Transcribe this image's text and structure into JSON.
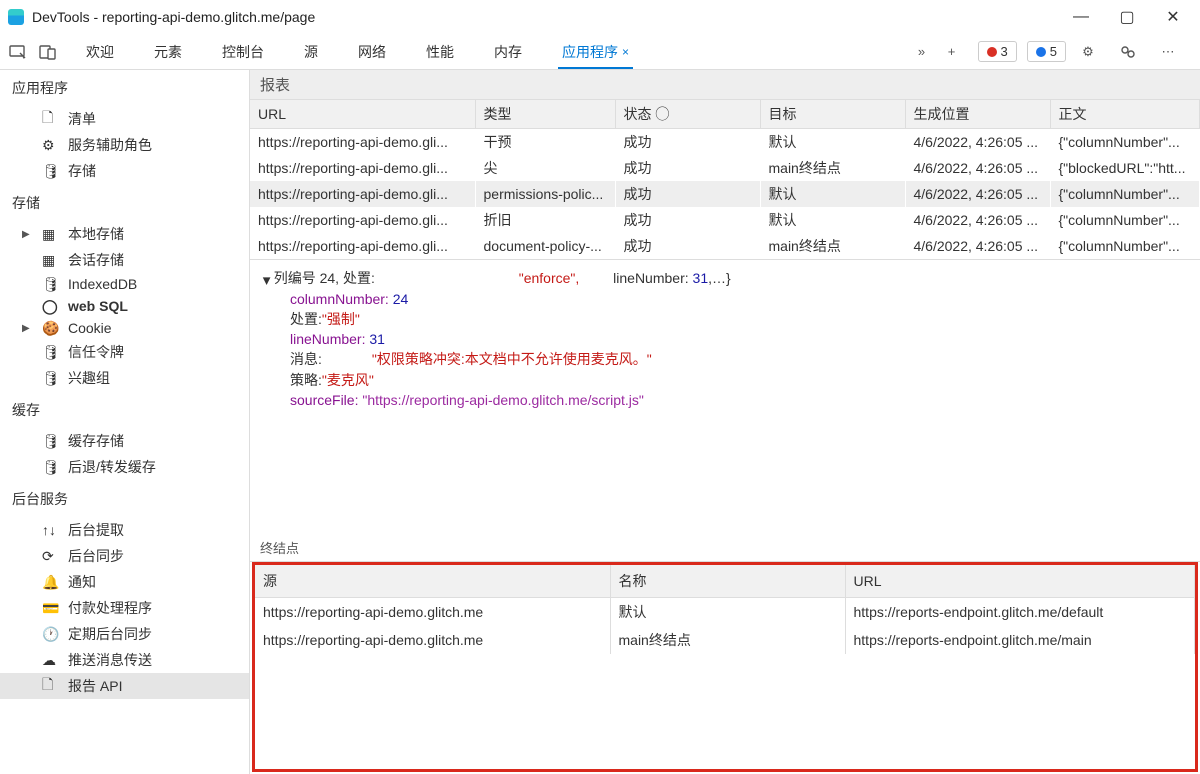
{
  "window": {
    "title": "DevTools - reporting-api-demo.glitch.me/page"
  },
  "tabs": {
    "items": [
      "欢迎",
      "元素",
      "控制台",
      "源",
      "网络",
      "性能",
      "内存",
      "应用程序"
    ],
    "active_close": "×"
  },
  "badges": {
    "errors": "3",
    "info": "5"
  },
  "sidebar": {
    "app_header": "应用程序",
    "app": {
      "manifest": "清单",
      "service_workers": "服务辅助角色",
      "storage": "存储"
    },
    "storage_header": "存储",
    "storage": {
      "local": "本地存储",
      "session": "会话存储",
      "indexeddb": "IndexedDB",
      "websql": "web SQL",
      "cookie": "Cookie",
      "trust": "信任令牌",
      "interest": "兴趣组"
    },
    "cache_header": "缓存",
    "cache": {
      "cache_storage": "缓存存储",
      "back_forward": "后退/转发缓存"
    },
    "bg_header": "后台服务",
    "bg": {
      "fetch": "后台提取",
      "sync": "后台同步",
      "notify": "通知",
      "payment": "付款处理程序",
      "periodic": "定期后台同步",
      "push": "推送消息传送",
      "report_api": "报告 API"
    }
  },
  "reports": {
    "title": "报表",
    "headers": {
      "url": "URL",
      "type": "类型",
      "status": "状态 ◯",
      "dest": "目标",
      "gen": "生成位置",
      "body": "正文"
    },
    "rows": [
      {
        "url": "https://reporting-api-demo.gli...",
        "type": "干预",
        "status": "成功",
        "dest": "默认",
        "gen": "4/6/2022, 4:26:05 ...",
        "body": "{\"columnNumber\"..."
      },
      {
        "url": "https://reporting-api-demo.gli...",
        "type": "尖",
        "status": "成功",
        "dest": "main终结点",
        "gen": "4/6/2022, 4:26:05 ...",
        "body": "{\"blockedURL\":\"htt..."
      },
      {
        "url": "https://reporting-api-demo.gli...",
        "type": "permissions-polic...",
        "status": "成功",
        "dest": "默认",
        "gen": "4/6/2022, 4:26:05 ...",
        "body": "{\"columnNumber\"..."
      },
      {
        "url": "https://reporting-api-demo.gli...",
        "type": "折旧",
        "status": "成功",
        "dest": "默认",
        "gen": "4/6/2022, 4:26:05 ...",
        "body": "{\"columnNumber\"..."
      },
      {
        "url": "https://reporting-api-demo.gli...",
        "type": "document-policy-...",
        "status": "成功",
        "dest": "main终结点",
        "gen": "4/6/2022, 4:26:05 ...",
        "body": "{\"columnNumber\"..."
      }
    ]
  },
  "details": {
    "line0_a": "列编号 24, 处置:",
    "line0_b": "\"enforce\",",
    "line0_c": "lineNumber: ",
    "line0_c_num": "31",
    "line0_d": ",…}",
    "colnum_key": "columnNumber:",
    "colnum_val": "24",
    "disp_key": "处置:",
    "disp_val": "\"强制\"",
    "linenum_key": "lineNumber:",
    "linenum_val": "31",
    "msg_key": "消息:",
    "msg_val": "\"权限策略冲突:本文档中不允许使用麦克风。\"",
    "policy_key": "策略:",
    "policy_val": "\"麦克风\"",
    "src_key": "sourceFile:",
    "src_val": "\"https://reporting-api-demo.glitch.me/script.js\""
  },
  "endpoints": {
    "title": "终结点",
    "headers": {
      "origin": "源",
      "name": "名称",
      "url": "URL"
    },
    "rows": [
      {
        "origin": "https://reporting-api-demo.glitch.me",
        "name": "默认",
        "url": "https://reports-endpoint.glitch.me/default"
      },
      {
        "origin": "https://reporting-api-demo.glitch.me",
        "name": "main终结点",
        "url": "https://reports-endpoint.glitch.me/main"
      }
    ]
  }
}
